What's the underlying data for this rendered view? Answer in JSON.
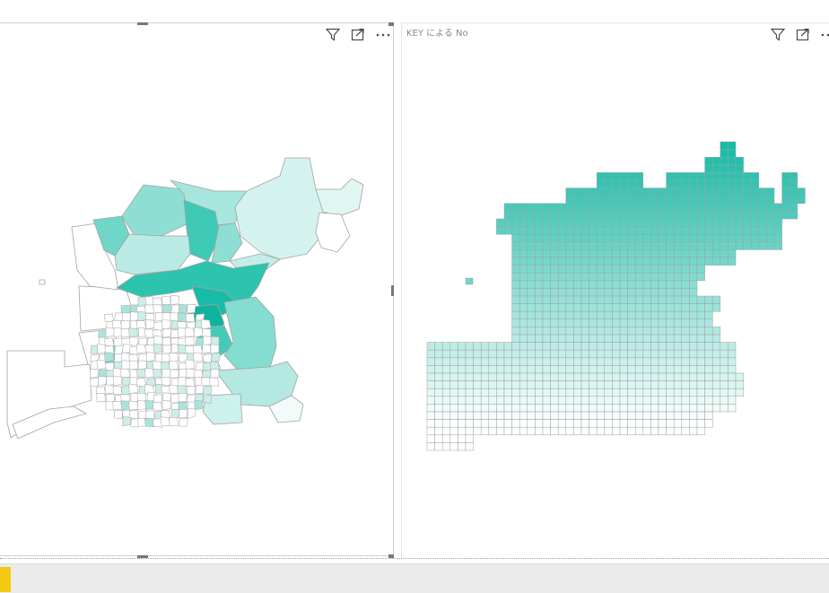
{
  "left_visual": {
    "title": "",
    "header_icons": [
      "filter-icon",
      "focus-mode-icon",
      "more-options-icon"
    ],
    "map_type": "filled-map",
    "fill_gradient": {
      "low": "#ffffff",
      "high": "#14bba6"
    },
    "region_border_color": "#9e9e9e"
  },
  "right_visual": {
    "title": "KEY による No",
    "header_icons": [
      "filter-icon",
      "focus-mode-icon",
      "more-options-icon"
    ],
    "map_type": "grid-map",
    "fill_gradient": {
      "low": "#ffffff",
      "high": "#14bba6"
    },
    "cell_border_color": "#9aa4a3"
  },
  "page_tabs": {
    "active_marker_color": "#f2c811"
  }
}
